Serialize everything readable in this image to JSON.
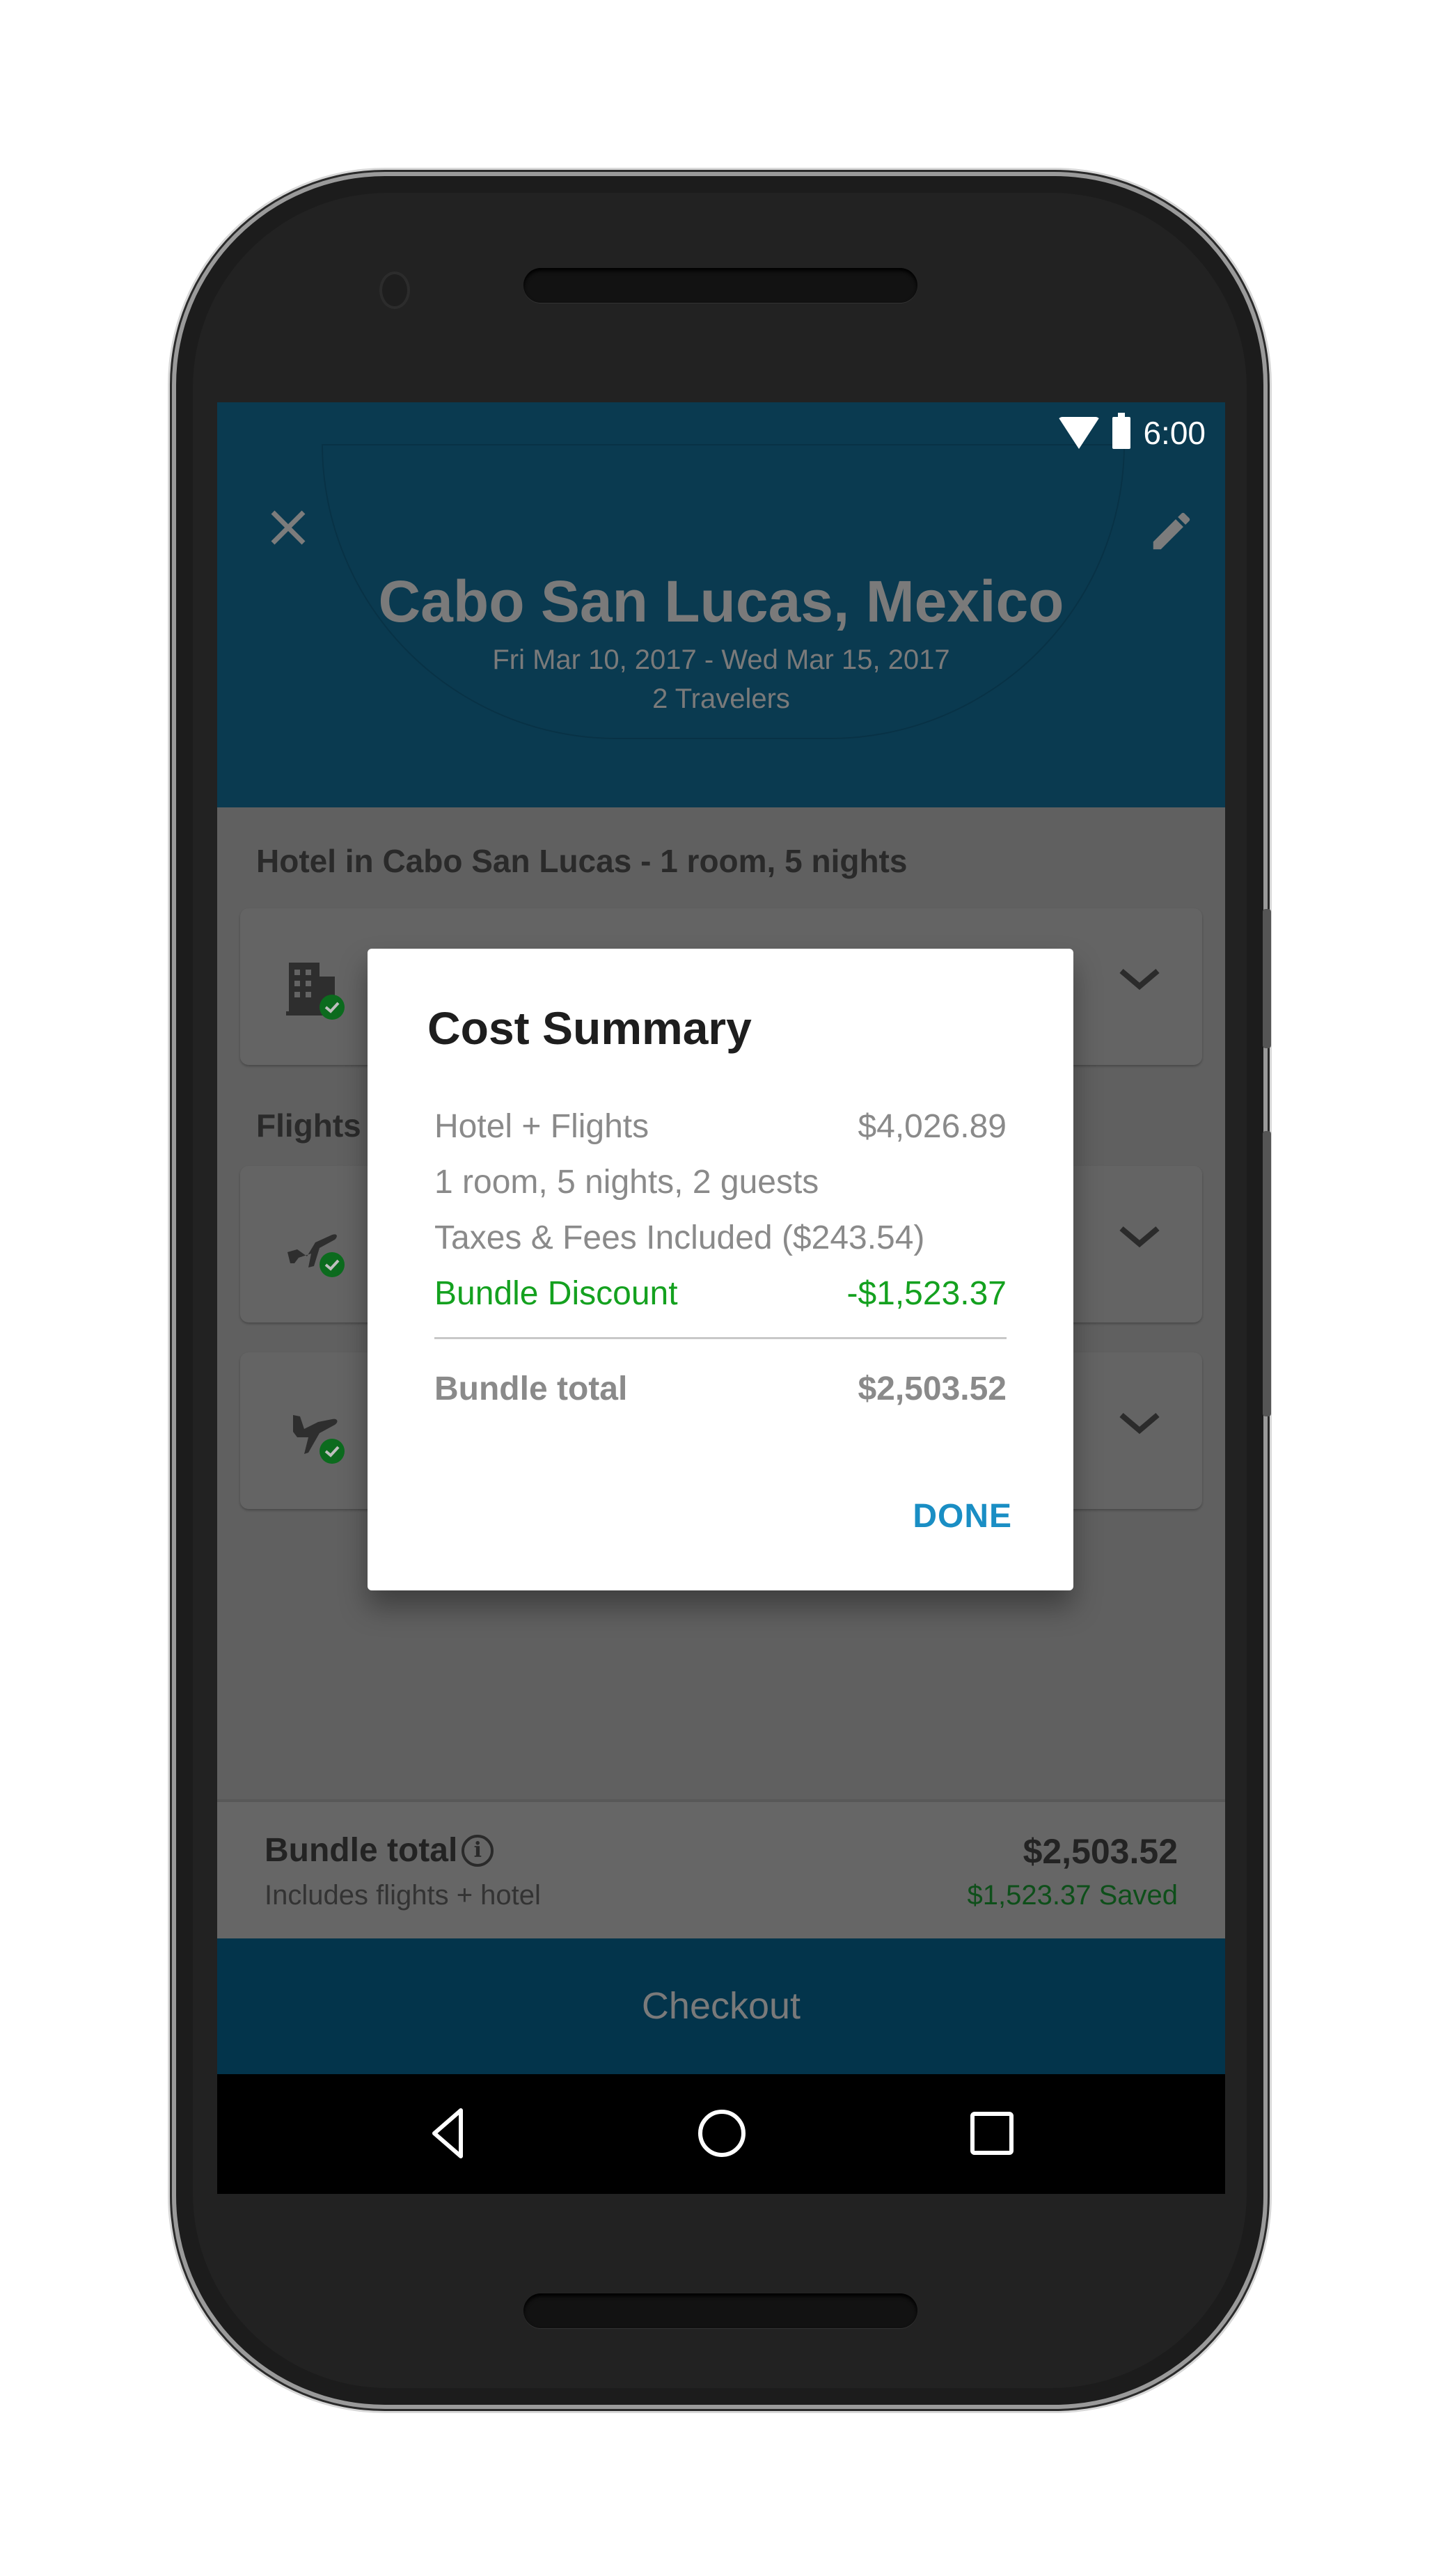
{
  "status_bar": {
    "time": "6:00",
    "wifi_icon": "wifi-icon",
    "battery_icon": "battery-icon"
  },
  "header": {
    "close_icon": "close-icon",
    "edit_icon": "pencil-icon",
    "destination": "Cabo San Lucas, Mexico",
    "dates": "Fri Mar 10, 2017 - Wed Mar 15, 2017",
    "travelers": "2 Travelers"
  },
  "sections": {
    "hotel_heading": "Hotel in Cabo San Lucas - 1 room, 5 nights",
    "flights_heading": "Flights"
  },
  "cards": [
    {
      "icon": "hotel-building-icon",
      "status_icon": "check-circle-icon",
      "expand_icon": "chevron-down-icon"
    },
    {
      "icon": "flight-takeoff-icon",
      "status_icon": "check-circle-icon",
      "expand_icon": "chevron-down-icon"
    },
    {
      "icon": "flight-landing-icon",
      "status_icon": "check-circle-icon",
      "expand_icon": "chevron-down-icon"
    }
  ],
  "bundle_bar": {
    "label": "Bundle total",
    "info_icon": "info-icon",
    "subtitle": "Includes flights + hotel",
    "total": "$2,503.52",
    "saved": "$1,523.37 Saved"
  },
  "checkout_label": "Checkout",
  "nav": {
    "back": "back-icon",
    "home": "home-icon",
    "recents": "recents-icon"
  },
  "dialog": {
    "title": "Cost Summary",
    "rows": [
      {
        "label": "Hotel + Flights",
        "value": "$4,026.89"
      },
      {
        "label": "1 room, 5 nights, 2 guests",
        "value": ""
      },
      {
        "label": "Taxes & Fees Included ($243.54)",
        "value": ""
      },
      {
        "label": "Bundle Discount",
        "value": "-$1,523.37"
      }
    ],
    "total": {
      "label": "Bundle total",
      "value": "$2,503.52"
    },
    "done_label": "DONE"
  },
  "colors": {
    "header_bg": "#0a3a50",
    "checkout_bg": "#03344b",
    "discount_green": "#14a11f",
    "saved_green": "#0e4f1a",
    "done_blue": "#1a8ec4",
    "check_green": "#0c6b1e"
  }
}
